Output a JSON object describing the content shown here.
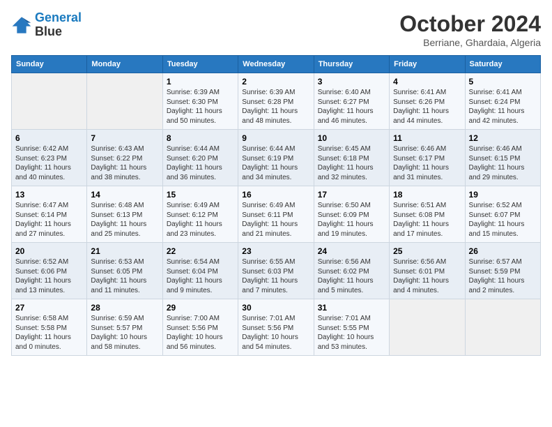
{
  "header": {
    "logo_line1": "General",
    "logo_line2": "Blue",
    "month_year": "October 2024",
    "location": "Berriane, Ghardaia, Algeria"
  },
  "weekdays": [
    "Sunday",
    "Monday",
    "Tuesday",
    "Wednesday",
    "Thursday",
    "Friday",
    "Saturday"
  ],
  "weeks": [
    [
      {
        "day": "",
        "sunrise": "",
        "sunset": "",
        "daylight": ""
      },
      {
        "day": "",
        "sunrise": "",
        "sunset": "",
        "daylight": ""
      },
      {
        "day": "1",
        "sunrise": "Sunrise: 6:39 AM",
        "sunset": "Sunset: 6:30 PM",
        "daylight": "Daylight: 11 hours and 50 minutes."
      },
      {
        "day": "2",
        "sunrise": "Sunrise: 6:39 AM",
        "sunset": "Sunset: 6:28 PM",
        "daylight": "Daylight: 11 hours and 48 minutes."
      },
      {
        "day": "3",
        "sunrise": "Sunrise: 6:40 AM",
        "sunset": "Sunset: 6:27 PM",
        "daylight": "Daylight: 11 hours and 46 minutes."
      },
      {
        "day": "4",
        "sunrise": "Sunrise: 6:41 AM",
        "sunset": "Sunset: 6:26 PM",
        "daylight": "Daylight: 11 hours and 44 minutes."
      },
      {
        "day": "5",
        "sunrise": "Sunrise: 6:41 AM",
        "sunset": "Sunset: 6:24 PM",
        "daylight": "Daylight: 11 hours and 42 minutes."
      }
    ],
    [
      {
        "day": "6",
        "sunrise": "Sunrise: 6:42 AM",
        "sunset": "Sunset: 6:23 PM",
        "daylight": "Daylight: 11 hours and 40 minutes."
      },
      {
        "day": "7",
        "sunrise": "Sunrise: 6:43 AM",
        "sunset": "Sunset: 6:22 PM",
        "daylight": "Daylight: 11 hours and 38 minutes."
      },
      {
        "day": "8",
        "sunrise": "Sunrise: 6:44 AM",
        "sunset": "Sunset: 6:20 PM",
        "daylight": "Daylight: 11 hours and 36 minutes."
      },
      {
        "day": "9",
        "sunrise": "Sunrise: 6:44 AM",
        "sunset": "Sunset: 6:19 PM",
        "daylight": "Daylight: 11 hours and 34 minutes."
      },
      {
        "day": "10",
        "sunrise": "Sunrise: 6:45 AM",
        "sunset": "Sunset: 6:18 PM",
        "daylight": "Daylight: 11 hours and 32 minutes."
      },
      {
        "day": "11",
        "sunrise": "Sunrise: 6:46 AM",
        "sunset": "Sunset: 6:17 PM",
        "daylight": "Daylight: 11 hours and 31 minutes."
      },
      {
        "day": "12",
        "sunrise": "Sunrise: 6:46 AM",
        "sunset": "Sunset: 6:15 PM",
        "daylight": "Daylight: 11 hours and 29 minutes."
      }
    ],
    [
      {
        "day": "13",
        "sunrise": "Sunrise: 6:47 AM",
        "sunset": "Sunset: 6:14 PM",
        "daylight": "Daylight: 11 hours and 27 minutes."
      },
      {
        "day": "14",
        "sunrise": "Sunrise: 6:48 AM",
        "sunset": "Sunset: 6:13 PM",
        "daylight": "Daylight: 11 hours and 25 minutes."
      },
      {
        "day": "15",
        "sunrise": "Sunrise: 6:49 AM",
        "sunset": "Sunset: 6:12 PM",
        "daylight": "Daylight: 11 hours and 23 minutes."
      },
      {
        "day": "16",
        "sunrise": "Sunrise: 6:49 AM",
        "sunset": "Sunset: 6:11 PM",
        "daylight": "Daylight: 11 hours and 21 minutes."
      },
      {
        "day": "17",
        "sunrise": "Sunrise: 6:50 AM",
        "sunset": "Sunset: 6:09 PM",
        "daylight": "Daylight: 11 hours and 19 minutes."
      },
      {
        "day": "18",
        "sunrise": "Sunrise: 6:51 AM",
        "sunset": "Sunset: 6:08 PM",
        "daylight": "Daylight: 11 hours and 17 minutes."
      },
      {
        "day": "19",
        "sunrise": "Sunrise: 6:52 AM",
        "sunset": "Sunset: 6:07 PM",
        "daylight": "Daylight: 11 hours and 15 minutes."
      }
    ],
    [
      {
        "day": "20",
        "sunrise": "Sunrise: 6:52 AM",
        "sunset": "Sunset: 6:06 PM",
        "daylight": "Daylight: 11 hours and 13 minutes."
      },
      {
        "day": "21",
        "sunrise": "Sunrise: 6:53 AM",
        "sunset": "Sunset: 6:05 PM",
        "daylight": "Daylight: 11 hours and 11 minutes."
      },
      {
        "day": "22",
        "sunrise": "Sunrise: 6:54 AM",
        "sunset": "Sunset: 6:04 PM",
        "daylight": "Daylight: 11 hours and 9 minutes."
      },
      {
        "day": "23",
        "sunrise": "Sunrise: 6:55 AM",
        "sunset": "Sunset: 6:03 PM",
        "daylight": "Daylight: 11 hours and 7 minutes."
      },
      {
        "day": "24",
        "sunrise": "Sunrise: 6:56 AM",
        "sunset": "Sunset: 6:02 PM",
        "daylight": "Daylight: 11 hours and 5 minutes."
      },
      {
        "day": "25",
        "sunrise": "Sunrise: 6:56 AM",
        "sunset": "Sunset: 6:01 PM",
        "daylight": "Daylight: 11 hours and 4 minutes."
      },
      {
        "day": "26",
        "sunrise": "Sunrise: 6:57 AM",
        "sunset": "Sunset: 5:59 PM",
        "daylight": "Daylight: 11 hours and 2 minutes."
      }
    ],
    [
      {
        "day": "27",
        "sunrise": "Sunrise: 6:58 AM",
        "sunset": "Sunset: 5:58 PM",
        "daylight": "Daylight: 11 hours and 0 minutes."
      },
      {
        "day": "28",
        "sunrise": "Sunrise: 6:59 AM",
        "sunset": "Sunset: 5:57 PM",
        "daylight": "Daylight: 10 hours and 58 minutes."
      },
      {
        "day": "29",
        "sunrise": "Sunrise: 7:00 AM",
        "sunset": "Sunset: 5:56 PM",
        "daylight": "Daylight: 10 hours and 56 minutes."
      },
      {
        "day": "30",
        "sunrise": "Sunrise: 7:01 AM",
        "sunset": "Sunset: 5:56 PM",
        "daylight": "Daylight: 10 hours and 54 minutes."
      },
      {
        "day": "31",
        "sunrise": "Sunrise: 7:01 AM",
        "sunset": "Sunset: 5:55 PM",
        "daylight": "Daylight: 10 hours and 53 minutes."
      },
      {
        "day": "",
        "sunrise": "",
        "sunset": "",
        "daylight": ""
      },
      {
        "day": "",
        "sunrise": "",
        "sunset": "",
        "daylight": ""
      }
    ]
  ]
}
